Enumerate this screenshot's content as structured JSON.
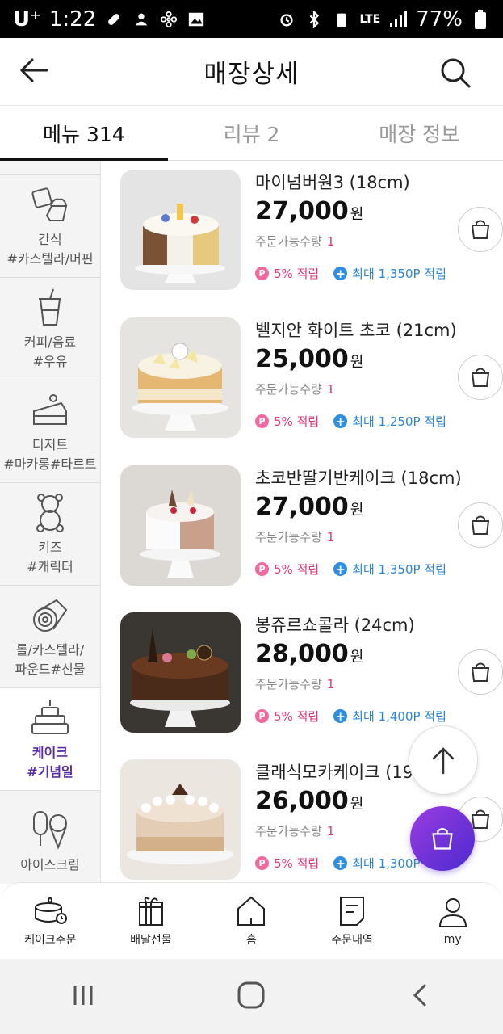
{
  "status_bar": {
    "carrier": "U⁺",
    "time": "1:22",
    "network": "LTE",
    "battery": "77%"
  },
  "header": {
    "title": "매장상세"
  },
  "tabs": [
    {
      "label": "메뉴 314"
    },
    {
      "label": "리뷰 2"
    },
    {
      "label": "매장 정보"
    }
  ],
  "sidebar": {
    "items": [
      {
        "line1": "간식",
        "line2": "#카스텔라/머핀",
        "icon": "snack-icon"
      },
      {
        "line1": "커피/음료",
        "line2": "#우유",
        "icon": "drink-icon"
      },
      {
        "line1": "디저트",
        "line2": "#마카롱#타르트",
        "icon": "cake-slice-icon"
      },
      {
        "line1": "키즈",
        "line2": "#캐릭터",
        "icon": "teddy-bear-icon"
      },
      {
        "line1": "롤/카스텔라/",
        "line2": "파운드#선물",
        "icon": "roll-cake-icon"
      },
      {
        "line1": "케이크",
        "line2": "#기념일",
        "icon": "cake-icon"
      },
      {
        "line1": "아이스크림",
        "line2": "",
        "icon": "ice-cream-icon"
      }
    ]
  },
  "products": [
    {
      "name": "마이넘버원3 (18cm)",
      "price": "27,000",
      "won": "원",
      "qty_label": "주문가능수량",
      "qty": "1",
      "point_rate": "5% 적립",
      "max_point": "최대 1,350P 적립"
    },
    {
      "name": "벨지안 화이트 초코 (21cm)",
      "price": "25,000",
      "won": "원",
      "qty_label": "주문가능수량",
      "qty": "1",
      "point_rate": "5% 적립",
      "max_point": "최대 1,250P 적립"
    },
    {
      "name": "초코반딸기반케이크 (18cm)",
      "price": "27,000",
      "won": "원",
      "qty_label": "주문가능수량",
      "qty": "1",
      "point_rate": "5% 적립",
      "max_point": "최대 1,350P 적립"
    },
    {
      "name": "봉쥬르쇼콜라 (24cm)",
      "price": "28,000",
      "won": "원",
      "qty_label": "주문가능수량",
      "qty": "1",
      "point_rate": "5% 적립",
      "max_point": "최대 1,400P 적립"
    },
    {
      "name": "클래식모카케이크 (19",
      "price": "26,000",
      "won": "원",
      "qty_label": "주문가능수량",
      "qty": "1",
      "point_rate": "5% 적립",
      "max_point": "최대 1,300P 적립"
    }
  ],
  "bottom_nav": [
    {
      "label": "케이크주문",
      "icon": "cake-order-icon"
    },
    {
      "label": "배달선물",
      "icon": "gift-icon"
    },
    {
      "label": "홈",
      "icon": "home-icon"
    },
    {
      "label": "주문내역",
      "icon": "order-history-icon"
    },
    {
      "label": "my",
      "icon": "user-icon"
    }
  ],
  "colors": {
    "accent_purple": "#5a2ca8",
    "point_pink": "#e0387a",
    "point_blue": "#2a85d4"
  }
}
